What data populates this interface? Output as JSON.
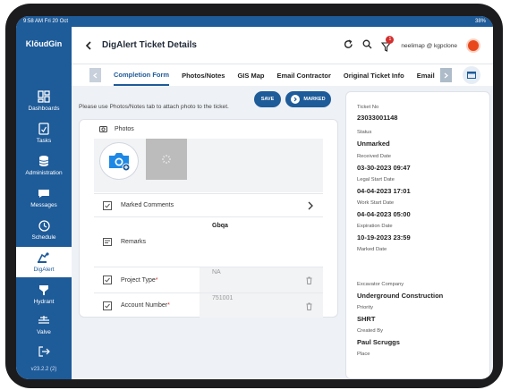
{
  "status_bar": {
    "time": "9:58 AM  Fri 20 Oct",
    "battery": "38%"
  },
  "sidebar": {
    "logo": "KlōudGin",
    "items": [
      {
        "label": "Dashboards",
        "icon": "dashboard-icon"
      },
      {
        "label": "Tasks",
        "icon": "tasks-icon"
      },
      {
        "label": "Administration",
        "icon": "database-icon"
      },
      {
        "label": "Messages",
        "icon": "messages-icon"
      },
      {
        "label": "Schedule",
        "icon": "clock-icon"
      },
      {
        "label": "DigAlert",
        "icon": "digger-icon",
        "active": true
      },
      {
        "label": "Hydrant",
        "icon": "hydrant-icon"
      },
      {
        "label": "Valve",
        "icon": "valve-icon"
      }
    ],
    "logout_icon": "logout-icon",
    "version": "v23.2.2 (2)"
  },
  "header": {
    "title": "DigAlert Ticket Details",
    "user": "neelimap @ kgpclone",
    "notification_count": "1"
  },
  "tabs": [
    "Completion Form",
    "Photos/Notes",
    "GIS Map",
    "Email Contractor",
    "Original Ticket Info",
    "Email"
  ],
  "form": {
    "hint": "Please use Photos/Notes tab to attach photo to the ticket.",
    "save_label": "SAVE",
    "marked_label": "MARKED",
    "photos_label": "Photos",
    "marked_comments_label": "Marked Comments",
    "remarks_label": "Remarks",
    "remarks_value": "Gbqa",
    "project_type_label": "Project Type",
    "project_type_value": "NA",
    "account_number_label": "Account Number",
    "account_number_value": "751001",
    "required_mark": "*"
  },
  "details": [
    {
      "key": "Ticket No",
      "value": "23033001148"
    },
    {
      "key": "Status",
      "value": "Unmarked"
    },
    {
      "key": "Received Date",
      "value": "03-30-2023 09:47"
    },
    {
      "key": "Legal Start Date",
      "value": "04-04-2023 17:01"
    },
    {
      "key": "Work Start Date",
      "value": "04-04-2023 05:00"
    },
    {
      "key": "Expiration Date",
      "value": "10-19-2023 23:59"
    },
    {
      "key": "Marked Date",
      "value": ""
    },
    {
      "key": "Excavator Company",
      "value": "Underground Construction"
    },
    {
      "key": "Priority",
      "value": "SHRT"
    },
    {
      "key": "Created By",
      "value": "Paul Scruggs"
    },
    {
      "key": "Place",
      "value": ""
    }
  ],
  "colors": {
    "brand": "#1e5b99",
    "required": "#d32f2f",
    "avatar": "#e8481c"
  }
}
